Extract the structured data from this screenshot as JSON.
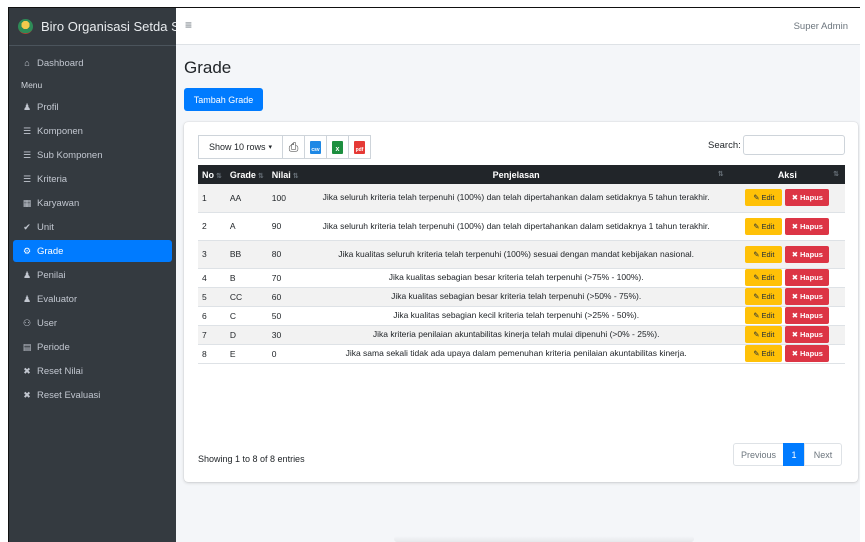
{
  "sidebar": {
    "brand": "Biro Organisasi Setda Su",
    "menu_header": "Menu",
    "items": [
      {
        "label": "Dashboard",
        "icon": "home-icon",
        "glyph": "⌂"
      },
      {
        "label": "Profil",
        "icon": "user-icon",
        "glyph": "♟"
      },
      {
        "label": "Komponen",
        "icon": "list-icon",
        "glyph": "☰"
      },
      {
        "label": "Sub Komponen",
        "icon": "list-icon",
        "glyph": "☰"
      },
      {
        "label": "Kriteria",
        "icon": "list-icon",
        "glyph": "☰"
      },
      {
        "label": "Karyawan",
        "icon": "building-icon",
        "glyph": "▦"
      },
      {
        "label": "Unit",
        "icon": "check-icon",
        "glyph": "✔"
      },
      {
        "label": "Grade",
        "icon": "gear-icon",
        "glyph": "⚙"
      },
      {
        "label": "Penilai",
        "icon": "user-icon",
        "glyph": "♟"
      },
      {
        "label": "Evaluator",
        "icon": "user-icon",
        "glyph": "♟"
      },
      {
        "label": "User",
        "icon": "users-icon",
        "glyph": "⚇"
      },
      {
        "label": "Periode",
        "icon": "calendar-icon",
        "glyph": "▤"
      },
      {
        "label": "Reset Nilai",
        "icon": "x-icon",
        "glyph": "✖"
      },
      {
        "label": "Reset Evaluasi",
        "icon": "x-icon",
        "glyph": "✖"
      }
    ],
    "active_item": "Grade"
  },
  "topbar": {
    "menu_icon": "≡",
    "user": "Super Admin"
  },
  "page": {
    "title": "Grade",
    "add_button": "Tambah Grade"
  },
  "toolbar": {
    "show_rows": "Show 10 rows",
    "caret": "▾",
    "print_glyph": "⎙",
    "csv_label": "csv",
    "excel_label": "x",
    "pdf_label": "pdf",
    "search_label": "Search:",
    "search_value": ""
  },
  "table": {
    "columns": [
      "No",
      "Grade",
      "Nilai",
      "Penjelasan",
      "Aksi"
    ],
    "sort_glyph": "⇅",
    "rows": [
      {
        "no": "1",
        "grade": "AA",
        "nilai": "100",
        "penjelasan": "Jika seluruh kriteria telah terpenuhi (100%) dan telah dipertahankan dalam setidaknya 5 tahun terakhir."
      },
      {
        "no": "2",
        "grade": "A",
        "nilai": "90",
        "penjelasan": "Jika seluruh kriteria telah terpenuhi (100%) dan telah dipertahankan dalam setidaknya 1 tahun terakhir."
      },
      {
        "no": "3",
        "grade": "BB",
        "nilai": "80",
        "penjelasan": "Jika kualitas seluruh kriteria telah terpenuhi (100%) sesuai dengan mandat kebijakan nasional."
      },
      {
        "no": "4",
        "grade": "B",
        "nilai": "70",
        "penjelasan": "Jika kualitas sebagian besar kriteria telah terpenuhi (>75% - 100%)."
      },
      {
        "no": "5",
        "grade": "CC",
        "nilai": "60",
        "penjelasan": "Jika kualitas sebagian besar kriteria telah terpenuhi (>50% - 75%)."
      },
      {
        "no": "6",
        "grade": "C",
        "nilai": "50",
        "penjelasan": "Jika kualitas sebagian kecil kriteria telah terpenuhi (>25% - 50%)."
      },
      {
        "no": "7",
        "grade": "D",
        "nilai": "30",
        "penjelasan": "Jika kriteria penilaian akuntabilitas kinerja telah mulai dipenuhi (>0% - 25%)."
      },
      {
        "no": "8",
        "grade": "E",
        "nilai": "0",
        "penjelasan": "Jika sama sekali tidak ada upaya dalam pemenuhan kriteria penilaian akuntabilitas kinerja."
      }
    ],
    "edit_label": "Edit",
    "edit_glyph": "✎",
    "delete_label": "Hapus",
    "delete_glyph": "✖"
  },
  "footer": {
    "info": "Showing 1 to 8 of 8 entries",
    "previous": "Previous",
    "current_page": "1",
    "next": "Next"
  },
  "colors": {
    "sidebar_bg": "#343a40",
    "primary": "#007bff",
    "warning": "#ffc107",
    "danger": "#dc3545",
    "table_head": "#212529"
  }
}
